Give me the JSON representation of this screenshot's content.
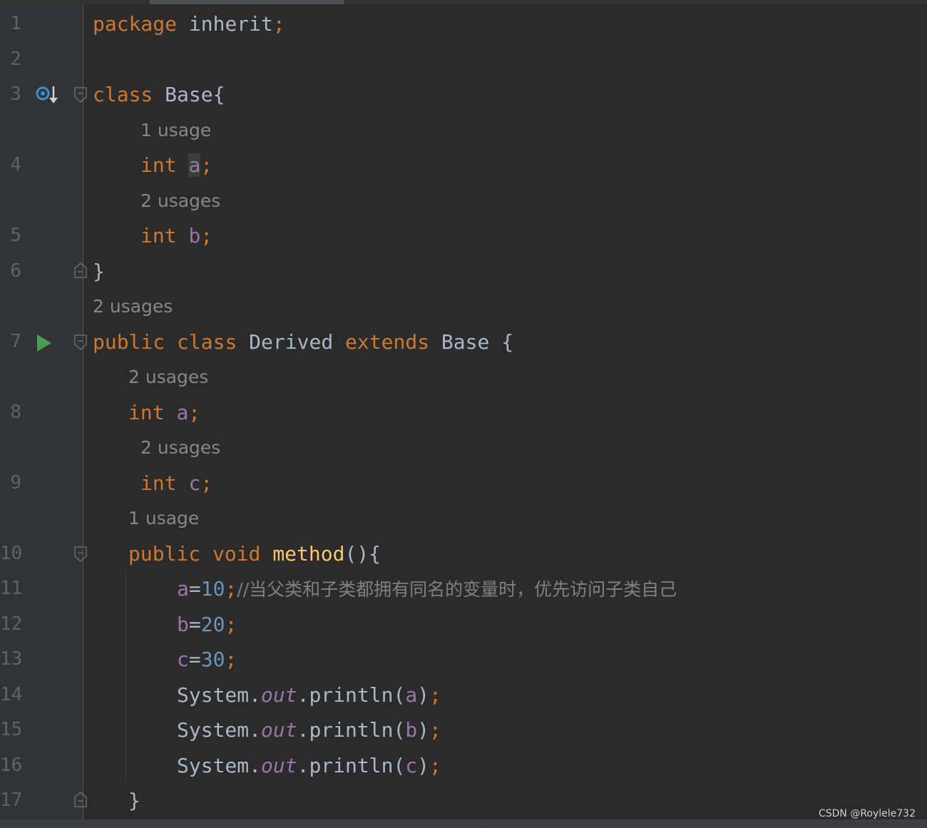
{
  "editor": {
    "watermark": "CSDN @Roylele732",
    "lines": {
      "l1": {
        "num": "1",
        "kw_package": "package",
        "pkg": "inherit",
        "semi": ";"
      },
      "l2": {
        "num": "2"
      },
      "l3": {
        "num": "3",
        "kw_class": "class",
        "name": "Base",
        "brace": "{"
      },
      "h4": {
        "text": "1 usage"
      },
      "l4": {
        "num": "4",
        "kw_int": "int",
        "field": "a",
        "semi": ";"
      },
      "h5": {
        "text": "2 usages"
      },
      "l5": {
        "num": "5",
        "kw_int": "int",
        "field": "b",
        "semi": ";"
      },
      "l6": {
        "num": "6",
        "brace": "}"
      },
      "h7": {
        "text": "2 usages"
      },
      "l7": {
        "num": "7",
        "kw_public": "public",
        "kw_class": "class",
        "name": "Derived",
        "kw_extends": "extends",
        "parent": "Base",
        "brace": "{"
      },
      "h8": {
        "text": "2 usages"
      },
      "l8": {
        "num": "8",
        "kw_int": "int",
        "field": "a",
        "semi": ";"
      },
      "h9": {
        "text": "2 usages"
      },
      "l9": {
        "num": "9",
        "kw_int": "int",
        "field": "c",
        "semi": ";"
      },
      "h10": {
        "text": "1 usage"
      },
      "l10": {
        "num": "10",
        "kw_public": "public",
        "kw_void": "void",
        "method": "method",
        "rest": "(){"
      },
      "l11": {
        "num": "11",
        "field": "a",
        "eq": "=",
        "value": "10",
        "semi": ";",
        "comment": "//当父类和子类都拥有同名的变量时，优先访问子类自己"
      },
      "l12": {
        "num": "12",
        "field": "b",
        "eq": "=",
        "value": "20",
        "semi": ";"
      },
      "l13": {
        "num": "13",
        "field": "c",
        "eq": "=",
        "value": "30",
        "semi": ";"
      },
      "l14": {
        "num": "14",
        "sys": "System.",
        "out": "out",
        "call": ".println(",
        "arg": "a",
        "close": ")",
        "semi": ";"
      },
      "l15": {
        "num": "15",
        "sys": "System.",
        "out": "out",
        "call": ".println(",
        "arg": "b",
        "close": ")",
        "semi": ";"
      },
      "l16": {
        "num": "16",
        "sys": "System.",
        "out": "out",
        "call": ".println(",
        "arg": "c",
        "close": ")",
        "semi": ";"
      },
      "l17": {
        "num": "17",
        "brace": "}"
      }
    }
  },
  "colors": {
    "background": "#2b2b2b",
    "gutter": "#313335",
    "keyword": "#cc7832",
    "field": "#9876aa",
    "number": "#6897bb",
    "method_decl": "#ffc66d",
    "comment": "#808080",
    "plain": "#a9b7c6",
    "inlay_hint": "#878787",
    "run_icon": "#499c54"
  },
  "icons": [
    "run-icon",
    "overridden-icon",
    "fold-icon"
  ]
}
